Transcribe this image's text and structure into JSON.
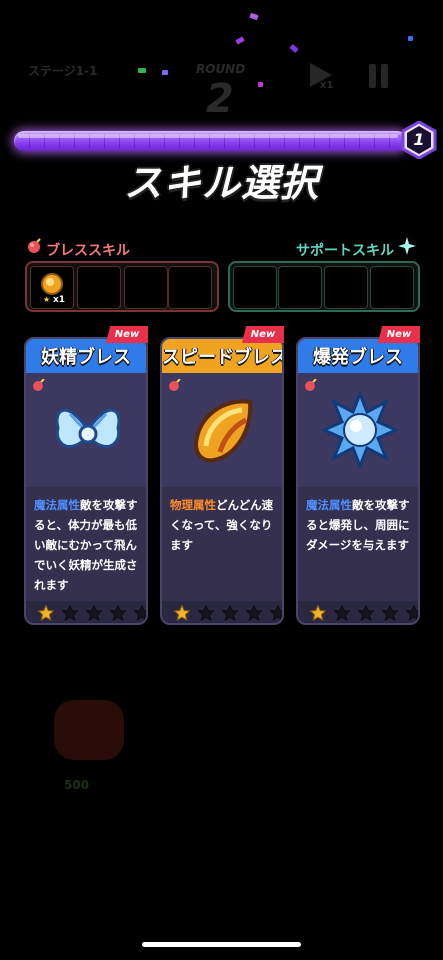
{
  "hud": {
    "stage_text": "ステージ1-1",
    "round_text": "ROUND",
    "round_number": "2",
    "speed_text": "x1"
  },
  "progress": {
    "level": "1",
    "fill": 1.0
  },
  "title": "スキル選択",
  "breath_skills": {
    "label": "ブレススキル",
    "first_slot_count": "x1"
  },
  "support_skills": {
    "label": "サポートスキル"
  },
  "cards": [
    {
      "name": "妖精ブレス",
      "badge": "New",
      "desc_keyword": "魔法属性",
      "desc_rest": "敵を攻撃すると、体力が最も低い敵にむかって飛んでいく妖精が生成されます",
      "stars": 1,
      "max_stars": 5,
      "header_color": "#2f7ce8",
      "keyword_color": "#4f8dff"
    },
    {
      "name": "スピードブレス",
      "badge": "New",
      "desc_keyword": "物理属性",
      "desc_rest": "どんどん速くなって、強くなります",
      "stars": 1,
      "max_stars": 5,
      "header_color": "#f0a320",
      "keyword_color": "#ff8a2a"
    },
    {
      "name": "爆発ブレス",
      "badge": "New",
      "desc_keyword": "魔法属性",
      "desc_rest": "敵を攻撃すると爆発し、周囲にダメージを与えます",
      "stars": 1,
      "max_stars": 5,
      "header_color": "#2f7ce8",
      "keyword_color": "#4f8dff"
    }
  ],
  "background": {
    "health_value": "500"
  }
}
